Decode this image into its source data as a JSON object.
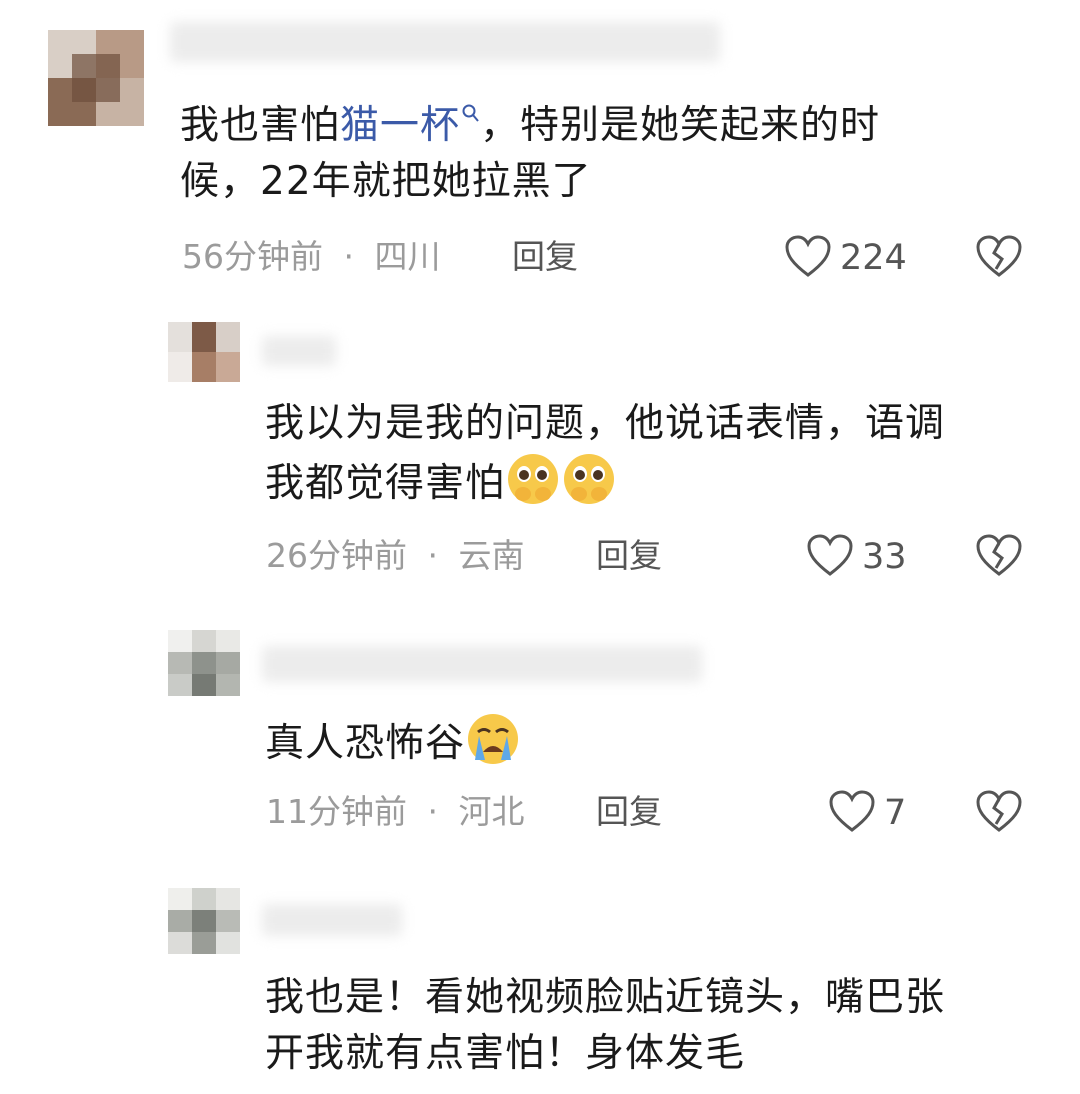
{
  "colors": {
    "text": "#1a1a1a",
    "meta": "#9b9b9b",
    "link": "#3b5aa8",
    "action": "#555555"
  },
  "comments": [
    {
      "text_before": "我也害怕",
      "mention": "猫一杯",
      "mention_icon": "search-icon",
      "text_line1_after": "，特别是她笑起来的时",
      "text_line2": "候，22年就把她拉黑了",
      "time": "56分钟前",
      "location": "四川",
      "reply": "回复",
      "likes": "224"
    },
    {
      "text_line1": "我以为是我的问题，他说话表情，语调",
      "text_line2": "我都觉得害怕",
      "emojis": [
        "pleading-face-icon",
        "pleading-face-icon"
      ],
      "time": "26分钟前",
      "location": "云南",
      "reply": "回复",
      "likes": "33"
    },
    {
      "text_line1": "真人恐怖谷",
      "emojis": [
        "crying-face-icon"
      ],
      "time": "11分钟前",
      "location": "河北",
      "reply": "回复",
      "likes": "7"
    },
    {
      "text_line1": "我也是！看她视频脸贴近镜头，嘴巴张",
      "text_line2": "开我就有点害怕！身体发毛"
    }
  ],
  "separator": "·"
}
